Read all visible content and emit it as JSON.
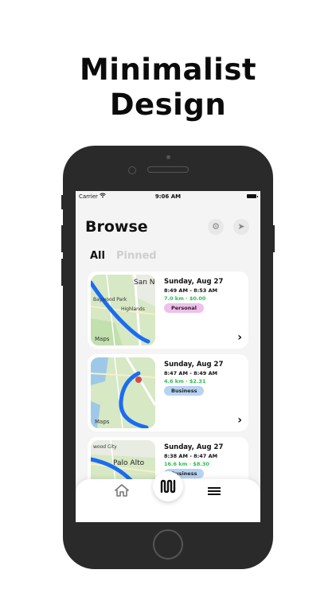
{
  "headline": {
    "line1": "Minimalist",
    "line2": "Design"
  },
  "status_bar": {
    "carrier": "Carrier",
    "time": "9:06 AM"
  },
  "header": {
    "title": "Browse",
    "icons": [
      "settings-icon",
      "location-icon"
    ]
  },
  "segments": {
    "all": "All",
    "pinned": "Pinned",
    "selected": "All"
  },
  "trips": [
    {
      "date": "Sunday, Aug 27",
      "time_range": "8:49 AM - 8:53 AM",
      "meta": "7.0 km · $0.00",
      "tag": "Personal",
      "map_labels": [
        "San N",
        "Baywood Park",
        "Highlands"
      ]
    },
    {
      "date": "Sunday, Aug 27",
      "time_range": "8:47 AM - 8:49 AM",
      "meta": "4.6 km · $2.31",
      "tag": "Business",
      "map_labels": []
    },
    {
      "date": "Sunday, Aug 27",
      "time_range": "8:38 AM - 8:47 AM",
      "meta": "16.6 km · $8.30",
      "tag": "Business",
      "map_labels": [
        "wood City",
        "Palo Alto"
      ]
    }
  ],
  "maps_attribution": "Maps",
  "tab_bar": {
    "items": [
      "home-icon",
      "trips-icon",
      "menu-icon"
    ]
  },
  "colors": {
    "accent_green": "#2bbf4e",
    "tag_personal": "#efc0ec",
    "tag_business": "#b7d3f3",
    "route_blue": "#1b6cf2"
  }
}
